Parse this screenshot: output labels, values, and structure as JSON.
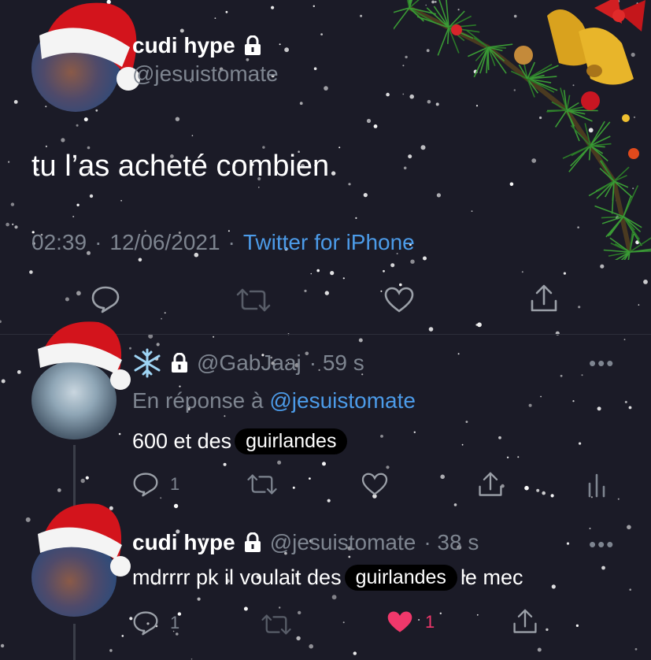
{
  "main_tweet": {
    "display_name": "cudi hype",
    "handle": "@jesuistomate",
    "text": "tu l’as acheté combien",
    "time": "02:39",
    "sep1": "·",
    "date": "12/06/2021",
    "sep2": "·",
    "source": "Twitter for iPhone"
  },
  "reply1": {
    "display_name_icon": "snowflake-icon",
    "handle": "@GabJaaj",
    "time": "· 59 s",
    "reply_prefix": "En réponse à",
    "reply_to": "@jesuistomate",
    "text_before": "600 et des",
    "censored": "guirlandes",
    "text_after": "",
    "reply_count": "1"
  },
  "reply2": {
    "display_name": "cudi hype",
    "handle": "@jesuistomate",
    "time": "· 38 s",
    "text_before": "mdrrrr pk il voulait des",
    "censored": "guirlandes",
    "text_after": "le mec",
    "reply_count": "1",
    "like_count": "1"
  },
  "colors": {
    "background": "#1b1b27",
    "link": "#4c9be8",
    "muted": "#7e8590",
    "like": "#f0386b"
  }
}
